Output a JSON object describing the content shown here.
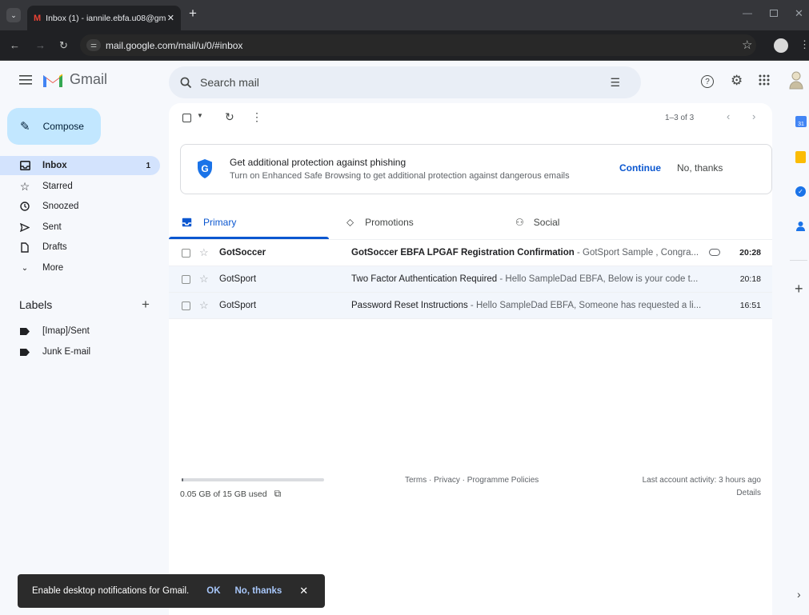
{
  "browser": {
    "tab_title": "Inbox (1) - iannile.ebfa.u08@gm",
    "url": "mail.google.com/mail/u/0/#inbox"
  },
  "gmail": {
    "logo_text": "Gmail",
    "search_placeholder": "Search mail",
    "compose_label": "Compose",
    "nav": [
      {
        "label": "Inbox",
        "count": "1",
        "icon": "inbox-icon"
      },
      {
        "label": "Starred",
        "icon": "star-icon"
      },
      {
        "label": "Snoozed",
        "icon": "clock-icon"
      },
      {
        "label": "Sent",
        "icon": "send-icon"
      },
      {
        "label": "Drafts",
        "icon": "draft-icon"
      },
      {
        "label": "More",
        "icon": "chevron-down-icon"
      }
    ],
    "labels_header": "Labels",
    "labels": [
      "[Imap]/Sent",
      "Junk E-mail"
    ],
    "pagination": "1–3 of 3",
    "banner": {
      "title": "Get additional protection against phishing",
      "body": "Turn on Enhanced Safe Browsing to get additional protection against dangerous emails",
      "continue": "Continue",
      "dismiss": "No, thanks"
    },
    "tabs": [
      "Primary",
      "Promotions",
      "Social"
    ],
    "emails": [
      {
        "from": "GotSoccer",
        "subject": "GotSoccer EBFA LPGAF Registration Confirmation",
        "snippet": " - GotSport Sample , Congra...",
        "time": "20:28",
        "unread": true,
        "attachment": true
      },
      {
        "from": "GotSport",
        "subject": "Two Factor Authentication Required",
        "snippet": " - Hello SampleDad EBFA, Below is your code t...",
        "time": "20:18",
        "unread": false,
        "attachment": false
      },
      {
        "from": "GotSport",
        "subject": "Password Reset Instructions",
        "snippet": " - Hello SampleDad EBFA, Someone has requested a li...",
        "time": "16:51",
        "unread": false,
        "attachment": false
      }
    ],
    "footer": {
      "storage": "0.05 GB of 15 GB used",
      "storage_fraction": 0.003,
      "links": "Terms · Privacy · Programme Policies",
      "activity": "Last account activity: 3 hours ago",
      "details": "Details"
    },
    "snackbar": {
      "text": "Enable desktop notifications for Gmail.",
      "ok": "OK",
      "dismiss": "No, thanks"
    }
  }
}
